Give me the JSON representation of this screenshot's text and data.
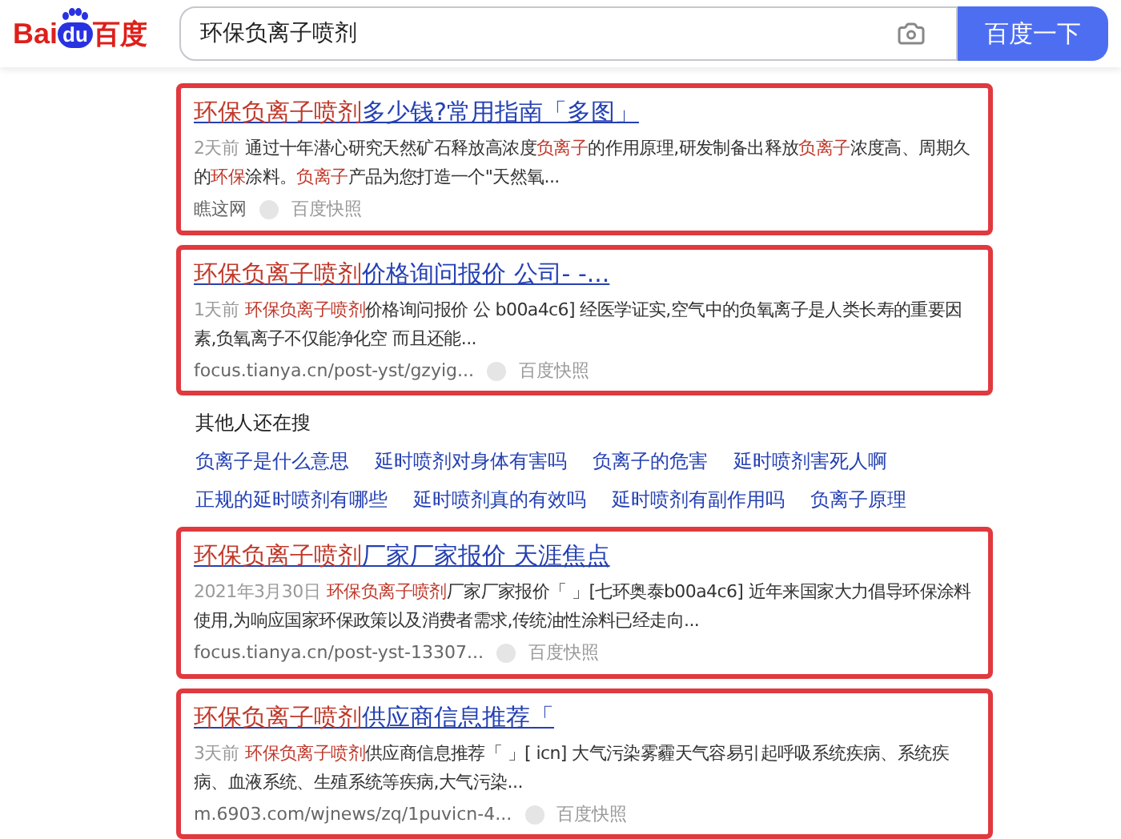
{
  "logo": {
    "left": "Bai",
    "paw": "du",
    "right": "百度"
  },
  "search": {
    "value": "环保负离子喷剂",
    "button": "百度一下"
  },
  "results": [
    {
      "title": [
        {
          "text": "环保负离子喷剂",
          "hl": true
        },
        {
          "text": "多少钱?常用指南「多图」",
          "hl": false
        }
      ],
      "meta": "2天前",
      "desc": [
        {
          "text": "通过十年潜心研究天然矿石释放高浓度",
          "hl": false
        },
        {
          "text": "负离子",
          "hl": true
        },
        {
          "text": "的作用原理,研发制备出释放",
          "hl": false
        },
        {
          "text": "负离子",
          "hl": true
        },
        {
          "text": "浓度高、周期久的",
          "hl": false
        },
        {
          "text": "环保",
          "hl": true
        },
        {
          "text": "涂料。",
          "hl": false
        },
        {
          "text": "负离子",
          "hl": true
        },
        {
          "text": "产品为您打造一个\"天然氧...",
          "hl": false
        }
      ],
      "source": "瞧这网",
      "snapshot": "百度快照"
    },
    {
      "title": [
        {
          "text": "环保负离子喷剂",
          "hl": true
        },
        {
          "text": "价格询问报价 公司- -...",
          "hl": false
        }
      ],
      "meta": "1天前",
      "desc": [
        {
          "text": "环保负离子喷剂",
          "hl": true
        },
        {
          "text": "价格询问报价 公 b00a4c6] 经医学证实,空气中的负氧离子是人类长寿的重要因素,负氧离子不仅能净化空 而且还能...",
          "hl": false
        }
      ],
      "source": "focus.tianya.cn/post-yst/gzyig...",
      "snapshot": "百度快照"
    },
    {
      "title": [
        {
          "text": "环保负离子喷剂",
          "hl": true
        },
        {
          "text": "厂家厂家报价 天涯焦点",
          "hl": false
        }
      ],
      "meta": "2021年3月30日",
      "desc": [
        {
          "text": "环保负离子喷剂",
          "hl": true
        },
        {
          "text": "厂家厂家报价「 」[七环奥泰b00a4c6] 近年来国家大力倡导环保涂料使用,为响应国家环保政策以及消费者需求,传统油性涂料已经走向...",
          "hl": false
        }
      ],
      "source": "focus.tianya.cn/post-yst-13307...",
      "snapshot": "百度快照"
    },
    {
      "title": [
        {
          "text": "环保负离子喷剂",
          "hl": true
        },
        {
          "text": "供应商信息推荐「",
          "hl": false
        }
      ],
      "meta": "3天前",
      "desc": [
        {
          "text": "环保负离子喷剂",
          "hl": true
        },
        {
          "text": "供应商信息推荐「 」[ icn] 大气污染雾霾天气容易引起呼吸系统疾病、系统疾病、血液系统、生殖系统等疾病,大气污染...",
          "hl": false
        }
      ],
      "source": "m.6903.com/wjnews/zq/1puvicn-4...",
      "snapshot": "百度快照"
    }
  ],
  "related": {
    "heading": "其他人还在搜",
    "rows": [
      [
        "负离子是什么意思",
        "延时喷剂对身体有害吗",
        "负离子的危害",
        "延时喷剂害死人啊"
      ],
      [
        "正规的延时喷剂有哪些",
        "延时喷剂真的有效吗",
        "延时喷剂有副作用吗",
        "负离子原理"
      ]
    ]
  }
}
